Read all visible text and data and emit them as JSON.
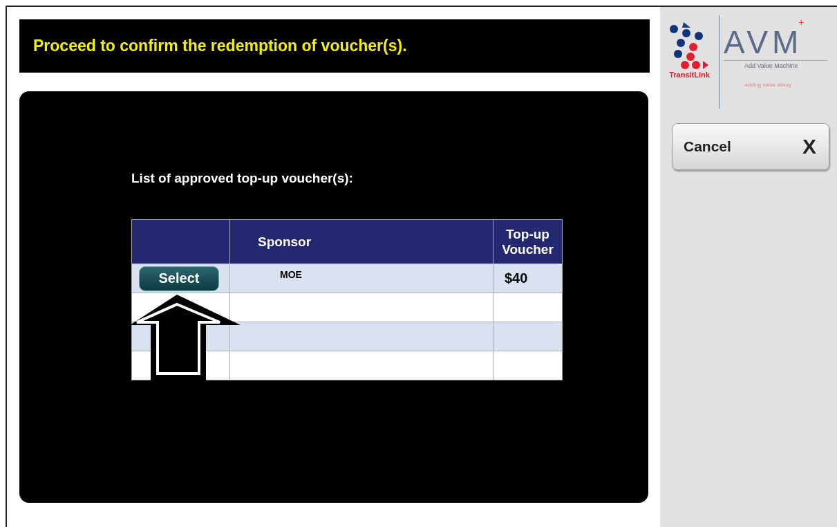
{
  "header": {
    "message": "Proceed to confirm the redemption of voucher(s)."
  },
  "panel": {
    "title": "List of approved top-up voucher(s):",
    "table": {
      "columns": [
        "Sponsor",
        "Top-up Voucher"
      ],
      "rows": [
        {
          "button": "Select",
          "sponsor": "MOE",
          "voucher": "$40"
        }
      ]
    }
  },
  "logo": {
    "brand": "TransitLink",
    "product": "AVM",
    "plus": "+",
    "tagline": "Add Value Machine",
    "slogan": "adding value alway"
  },
  "cancel_button": {
    "label": "Cancel",
    "icon": "X"
  }
}
